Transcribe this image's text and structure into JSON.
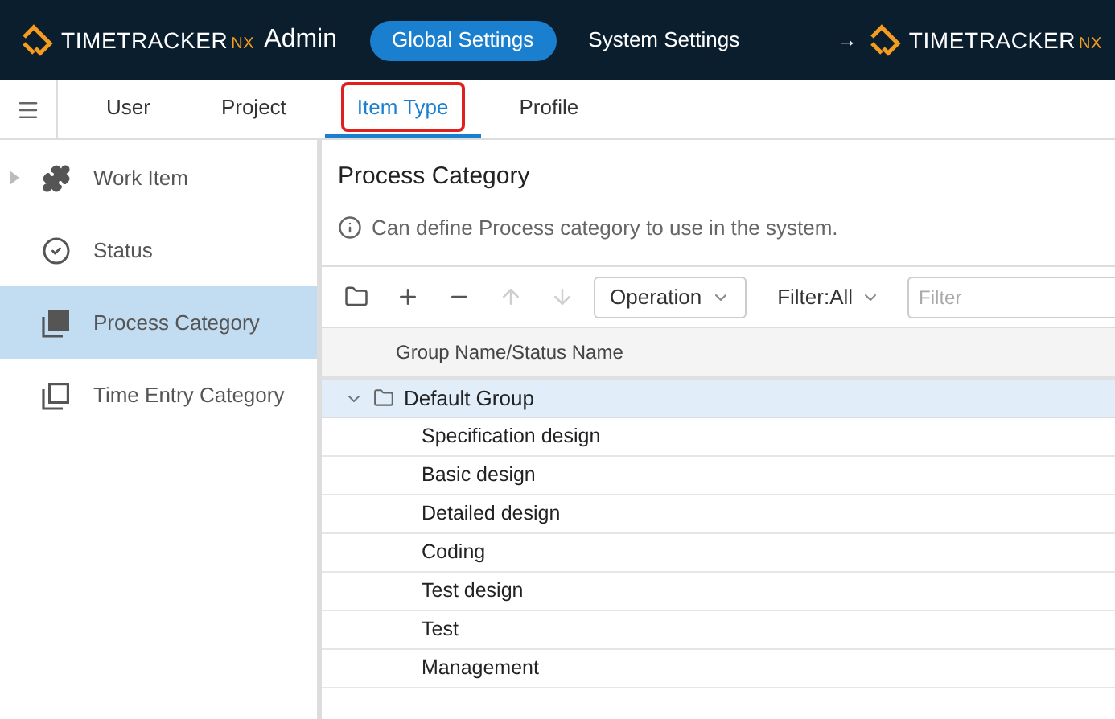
{
  "header": {
    "logo": {
      "name": "TIMETRACKER",
      "suffix": "NX"
    },
    "app_label": "Admin",
    "nav": [
      {
        "label": "Global Settings",
        "selected": true
      },
      {
        "label": "System Settings",
        "selected": false
      }
    ],
    "link_arrow": "→",
    "right_logo": {
      "name": "TIMETRACKER",
      "suffix": "NX"
    }
  },
  "tabs": [
    {
      "label": "User",
      "selected": false,
      "highlighted": false
    },
    {
      "label": "Project",
      "selected": false,
      "highlighted": false
    },
    {
      "label": "Item Type",
      "selected": true,
      "highlighted": true
    },
    {
      "label": "Profile",
      "selected": false,
      "highlighted": false
    }
  ],
  "sidebar": {
    "items": [
      {
        "label": "Work Item",
        "kind": "puzzle",
        "selected": false,
        "expandable": true
      },
      {
        "label": "Status",
        "kind": "check",
        "selected": false,
        "expandable": false
      },
      {
        "label": "Process Category",
        "kind": "stack-filled",
        "selected": true,
        "expandable": false
      },
      {
        "label": "Time Entry Category",
        "kind": "stack",
        "selected": false,
        "expandable": false
      }
    ]
  },
  "main": {
    "title": "Process Category",
    "info": "Can define Process category to use in the system.",
    "toolbar": {
      "buttons": [
        {
          "kind": "folder",
          "disabled": false
        },
        {
          "kind": "plus",
          "disabled": false
        },
        {
          "kind": "minus",
          "disabled": false
        },
        {
          "kind": "up",
          "disabled": true
        },
        {
          "kind": "down",
          "disabled": true
        }
      ],
      "operation": "Operation",
      "filter": "Filter:All",
      "filter_placeholder": "Filter"
    },
    "table": {
      "column": "Group Name/Status Name",
      "groups": [
        {
          "label": "Default Group",
          "expanded": true,
          "selected": true,
          "children": [
            {
              "label": "Specification design"
            },
            {
              "label": "Basic design"
            },
            {
              "label": "Detailed design"
            },
            {
              "label": "Coding"
            },
            {
              "label": "Test design"
            },
            {
              "label": "Test"
            },
            {
              "label": "Management"
            }
          ]
        }
      ]
    }
  }
}
